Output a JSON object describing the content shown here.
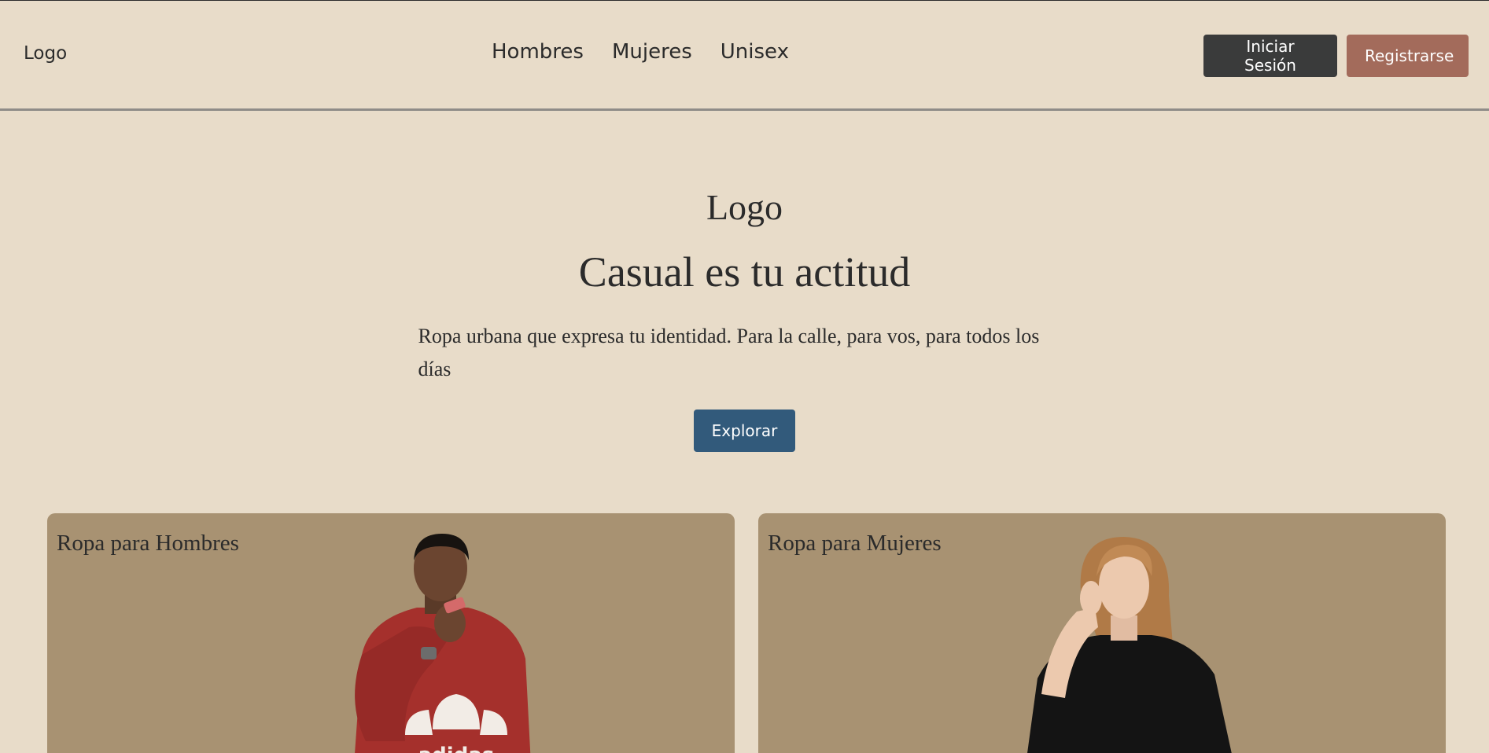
{
  "header": {
    "logo": "Logo",
    "nav": [
      "Hombres",
      "Mujeres",
      "Unisex"
    ],
    "login_label": "Iniciar Sesión",
    "register_label": "Registrarse"
  },
  "hero": {
    "logo": "Logo",
    "title": "Casual es tu actitud",
    "text": "Ropa urbana que expresa tu identidad. Para la calle, para vos, para todos los días",
    "cta_label": "Explorar"
  },
  "cards": [
    {
      "title": "Ropa para Hombres",
      "image": "man-red-adidas-sweater",
      "brand_text": "adidas"
    },
    {
      "title": "Ropa para Mujeres",
      "image": "woman-black-tshirt"
    }
  ],
  "colors": {
    "background": "#e8dcc9",
    "card": "#a89272",
    "login_button": "#3a3b3b",
    "register_button": "#a36b5b",
    "explore_button": "#325a7b"
  }
}
